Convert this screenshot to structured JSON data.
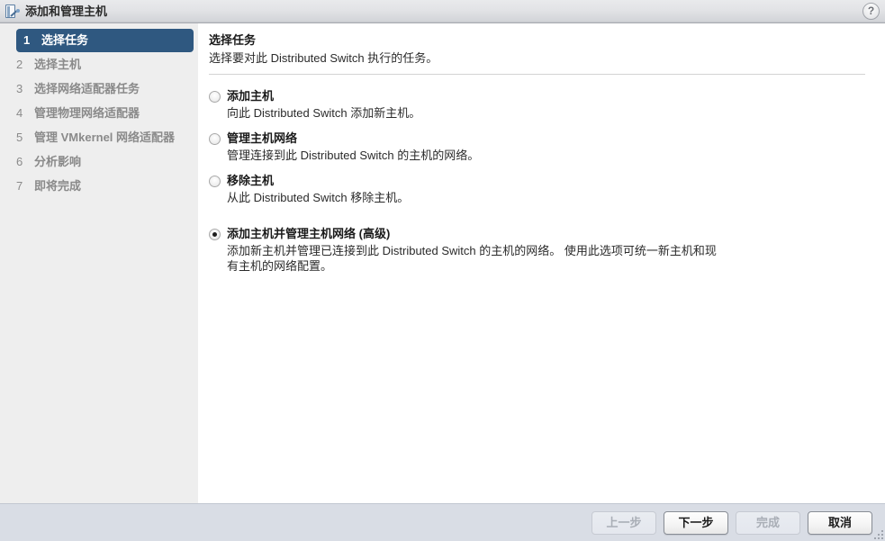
{
  "window": {
    "title": "添加和管理主机",
    "icon": "manage-hosts-icon",
    "help_icon": "?"
  },
  "sidebar": {
    "steps": [
      {
        "num": "1",
        "label": "选择任务",
        "active": true
      },
      {
        "num": "2",
        "label": "选择主机",
        "active": false
      },
      {
        "num": "3",
        "label": "选择网络适配器任务",
        "active": false
      },
      {
        "num": "4",
        "label": "管理物理网络适配器",
        "active": false
      },
      {
        "num": "5",
        "label": "管理 VMkernel 网络适配器",
        "active": false
      },
      {
        "num": "6",
        "label": "分析影响",
        "active": false
      },
      {
        "num": "7",
        "label": "即将完成",
        "active": false
      }
    ]
  },
  "content": {
    "heading": "选择任务",
    "subheading": "选择要对此 Distributed Switch 执行的任务。",
    "options": [
      {
        "title": "添加主机",
        "desc": "向此 Distributed Switch 添加新主机。",
        "selected": false
      },
      {
        "title": "管理主机网络",
        "desc": "管理连接到此 Distributed Switch 的主机的网络。",
        "selected": false
      },
      {
        "title": "移除主机",
        "desc": "从此 Distributed Switch 移除主机。",
        "selected": false
      },
      {
        "title": "添加主机并管理主机网络 (高级)",
        "desc": "添加新主机并管理已连接到此 Distributed Switch 的主机的网络。 使用此选项可统一新主机和现有主机的网络配置。",
        "selected": true
      }
    ]
  },
  "footer": {
    "buttons": [
      {
        "label": "上一步",
        "enabled": false
      },
      {
        "label": "下一步",
        "enabled": true
      },
      {
        "label": "完成",
        "enabled": false
      },
      {
        "label": "取消",
        "enabled": true
      }
    ]
  },
  "colors": {
    "accent": "#2f5880",
    "titlebar": "#e2e3e6",
    "sidebar_bg": "#eeeeee",
    "footer_bg": "#d9dde5"
  }
}
